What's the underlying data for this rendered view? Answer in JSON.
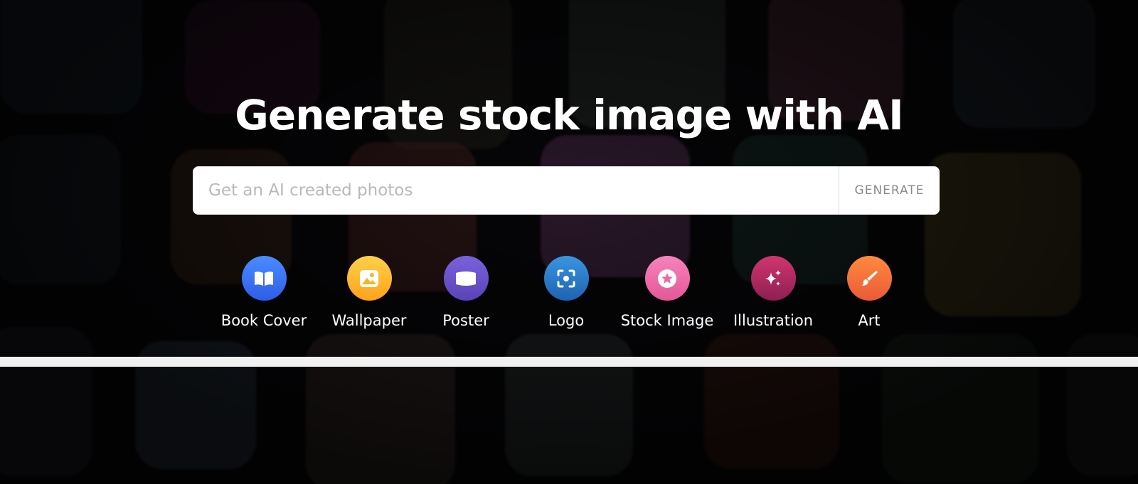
{
  "hero": {
    "title": "Generate stock image with AI"
  },
  "search": {
    "placeholder": "Get an AI created photos",
    "value": "",
    "button_label": "GENERATE"
  },
  "categories": [
    {
      "label": "Book Cover",
      "icon": "open-book-icon",
      "color": "#3b6df0"
    },
    {
      "label": "Wallpaper",
      "icon": "image-icon",
      "color": "#ffb21a"
    },
    {
      "label": "Poster",
      "icon": "banner-icon",
      "color": "#6a52c9"
    },
    {
      "label": "Logo",
      "icon": "focus-scan-icon",
      "color": "#2c7dd0"
    },
    {
      "label": "Stock Image",
      "icon": "star-icon",
      "color": "#ec6aa8"
    },
    {
      "label": "Illustration",
      "icon": "sparkles-icon",
      "color": "#b8265e"
    },
    {
      "label": "Art",
      "icon": "paintbrush-icon",
      "color": "#f26a3c"
    }
  ]
}
